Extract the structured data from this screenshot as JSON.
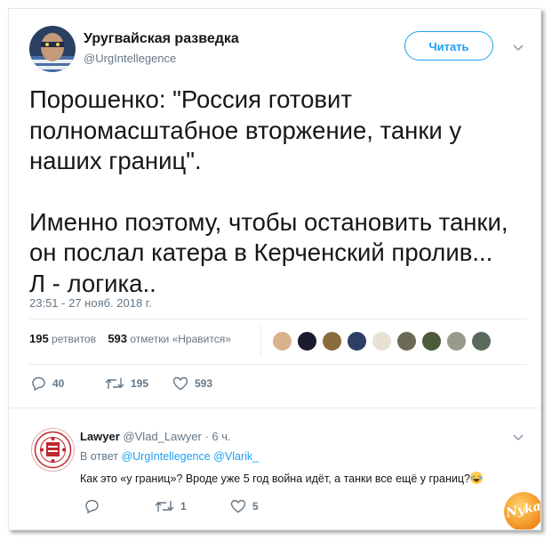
{
  "tweet": {
    "author_name": "Уругвайская разведка",
    "author_handle": "@UrgIntellegence",
    "follow_label": "Читать",
    "text_lines_1": [
      "Порошенко: \"Россия готовит",
      "полномасштабное вторжение, танки у",
      "наших границ\"."
    ],
    "text_lines_2": [
      "Именно поэтому, чтобы остановить танки,",
      "он послал катера в Керченский пролив...",
      "Л - логика.."
    ],
    "timestamp": "23:51 - 27 нояб. 2018 г.",
    "retweets_count": "195",
    "retweets_label": "ретвитов",
    "likes_count": "593",
    "likes_label": "отметки «Нравится»",
    "actions": {
      "replies": "40",
      "retweets": "195",
      "likes": "593"
    }
  },
  "reply": {
    "author_name": "Lawyer",
    "author_handle": "@Vlad_Lawyer",
    "time": "· 6 ч.",
    "in_reply_prefix": "В ответ",
    "in_reply_users": "@UrgIntellegence @Vlarik_",
    "text": "Как это «у границ»? Вроде уже 5 год война идёт, а танки все ещё у границ?",
    "actions": {
      "replies": "",
      "retweets": "1",
      "likes": "5"
    }
  },
  "watermark": "Nyka",
  "icons": [
    "chevron-down-icon",
    "reply-icon",
    "retweet-icon",
    "heart-icon",
    "emoji-laughing-icon"
  ],
  "colors": {
    "accent": "#1da1f2",
    "muted": "#657786",
    "text": "#14171a",
    "divider": "#e6ecf0"
  }
}
